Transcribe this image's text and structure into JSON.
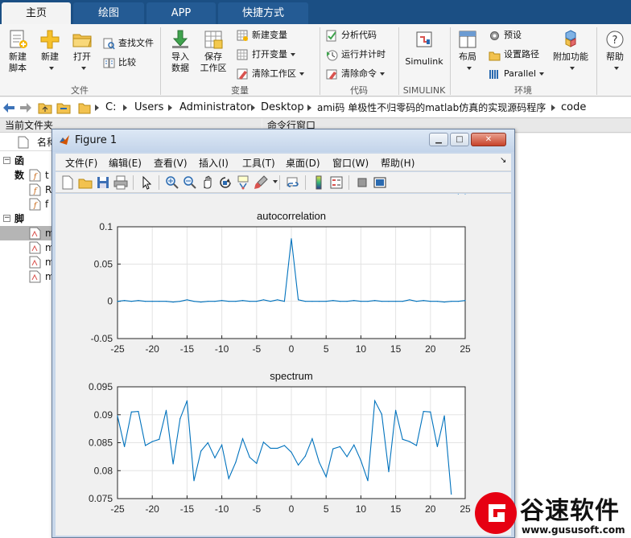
{
  "tabs": [
    {
      "label": "主页",
      "active": true
    },
    {
      "label": "绘图",
      "active": false
    },
    {
      "label": "APP",
      "active": false
    },
    {
      "label": "快捷方式",
      "active": false
    }
  ],
  "ribbon": {
    "file": {
      "new_script": "新建\n脚本",
      "new": "新建",
      "open": "打开",
      "find_files": "查找文件",
      "compare": "比较",
      "group_label": "文件"
    },
    "variable": {
      "import_data": "导入\n数据",
      "save_workspace": "保存\n工作区",
      "new_variable": "新建变量",
      "open_variable": "打开变量",
      "clear_workspace": "清除工作区",
      "group_label": "变量"
    },
    "code": {
      "analyze_code": "分析代码",
      "run_and_time": "运行并计时",
      "clear_commands": "清除命令",
      "group_label": "代码"
    },
    "simulink": {
      "simulink": "Simulink",
      "group_label": "SIMULINK"
    },
    "environment": {
      "layout": "布局",
      "preferences": "预设",
      "set_path": "设置路径",
      "parallel": "Parallel",
      "addons": "附加功能",
      "group_label": "环境"
    },
    "help": "帮助"
  },
  "address": {
    "crumbs": [
      "C:",
      "Users",
      "Administrator",
      "Desktop",
      "ami码 单极性不归零码的matlab仿真的实现源码程序",
      "code"
    ]
  },
  "left_panel": {
    "title": "当前文件夹",
    "name_header": "名称",
    "functions_label": "函数",
    "scripts_label": "脚本",
    "function_items": [
      "t",
      "R",
      "f"
    ],
    "script_items": [
      "m",
      "m",
      "m",
      "m"
    ]
  },
  "command_window": {
    "title": "命令行窗口"
  },
  "figure": {
    "title": "Figure 1",
    "menu": [
      "文件(F)",
      "编辑(E)",
      "查看(V)",
      "插入(I)",
      "工具(T)",
      "桌面(D)",
      "窗口(W)",
      "帮助(H)"
    ],
    "toolbar_icons": [
      "new-figure-icon",
      "open-file-icon",
      "save-icon",
      "print-icon",
      "pointer-icon",
      "zoom-in-icon",
      "zoom-out-icon",
      "pan-icon",
      "rotate-3d-icon",
      "data-cursor-icon",
      "brush-icon",
      "link-plot-icon",
      "colorbar-icon",
      "legend-icon",
      "hide-plot-tools-icon",
      "show-plot-tools-icon"
    ]
  },
  "chart_data": [
    {
      "type": "line",
      "title": "autocorrelation",
      "x": [
        -25,
        -24,
        -23,
        -22,
        -21,
        -20,
        -19,
        -18,
        -17,
        -16,
        -15,
        -14,
        -13,
        -12,
        -11,
        -10,
        -9,
        -8,
        -7,
        -6,
        -5,
        -4,
        -3,
        -2,
        -1,
        0,
        1,
        2,
        3,
        4,
        5,
        6,
        7,
        8,
        9,
        10,
        11,
        12,
        13,
        14,
        15,
        16,
        17,
        18,
        19,
        20,
        21,
        22,
        23,
        24,
        25
      ],
      "y": [
        0,
        0.001,
        0,
        0.001,
        0,
        0,
        0,
        0,
        -0.001,
        0,
        0.002,
        0,
        -0.001,
        0,
        0,
        0.001,
        0,
        0,
        0.001,
        0,
        0,
        0.002,
        0,
        0.002,
        0,
        0.084,
        0.002,
        0,
        0,
        0,
        0,
        0.001,
        0,
        0,
        0.001,
        0,
        0,
        0.001,
        0,
        0,
        0,
        0,
        0.002,
        0,
        0.001,
        0,
        0,
        -0.001,
        0,
        0,
        0.001
      ],
      "xlim": [
        -25,
        25
      ],
      "ylim": [
        -0.05,
        0.1
      ],
      "xticks": [
        -25,
        -20,
        -15,
        -10,
        -5,
        0,
        5,
        10,
        15,
        20,
        25
      ],
      "yticks": [
        0.1,
        0.05,
        0,
        -0.05
      ],
      "ytick_labels": [
        "0.1",
        "0.05",
        "0",
        "-0.05"
      ],
      "grid": true,
      "color": "#0072bd"
    },
    {
      "type": "line",
      "title": "spectrum",
      "x": [
        -25,
        -24,
        -23,
        -22,
        -21,
        -20,
        -19,
        -18,
        -17,
        -16,
        -15,
        -14,
        -13,
        -12,
        -11,
        -10,
        -9,
        -8,
        -7,
        -6,
        -5,
        -4,
        -3,
        -2,
        -1,
        0,
        1,
        2,
        3,
        4,
        5,
        6,
        7,
        8,
        9,
        10,
        11,
        12,
        13,
        14,
        15,
        16,
        17,
        18,
        19,
        20,
        21,
        22,
        23,
        24,
        25
      ],
      "y": [
        0.0898,
        0.0843,
        0.0905,
        0.0906,
        0.0845,
        0.0852,
        0.0856,
        0.0908,
        0.0812,
        0.0893,
        0.0925,
        0.0782,
        0.0835,
        0.085,
        0.0823,
        0.0846,
        0.0786,
        0.0815,
        0.0857,
        0.0824,
        0.0813,
        0.0851,
        0.084,
        0.084,
        0.0845,
        0.0833,
        0.081,
        0.0826,
        0.0857,
        0.0815,
        0.0789,
        0.0839,
        0.0843,
        0.0825,
        0.0846,
        0.0818,
        0.0782,
        0.0925,
        0.0901,
        0.0798,
        0.0908,
        0.0856,
        0.0852,
        0.0845,
        0.0906,
        0.0905,
        0.0843,
        0.0898,
        0.0758
      ],
      "xlim": [
        -25,
        25
      ],
      "ylim": [
        0.075,
        0.095
      ],
      "xticks": [
        -25,
        -20,
        -15,
        -10,
        -5,
        0,
        5,
        10,
        15,
        20,
        25
      ],
      "yticks": [
        0.095,
        0.09,
        0.085,
        0.08,
        0.075
      ],
      "ytick_labels": [
        "0.095",
        "0.09",
        "0.085",
        "0.08",
        "0.075"
      ],
      "grid": true,
      "color": "#0072bd"
    }
  ],
  "watermark": {
    "text": "谷速软件",
    "url": "www.gususoft.com"
  }
}
